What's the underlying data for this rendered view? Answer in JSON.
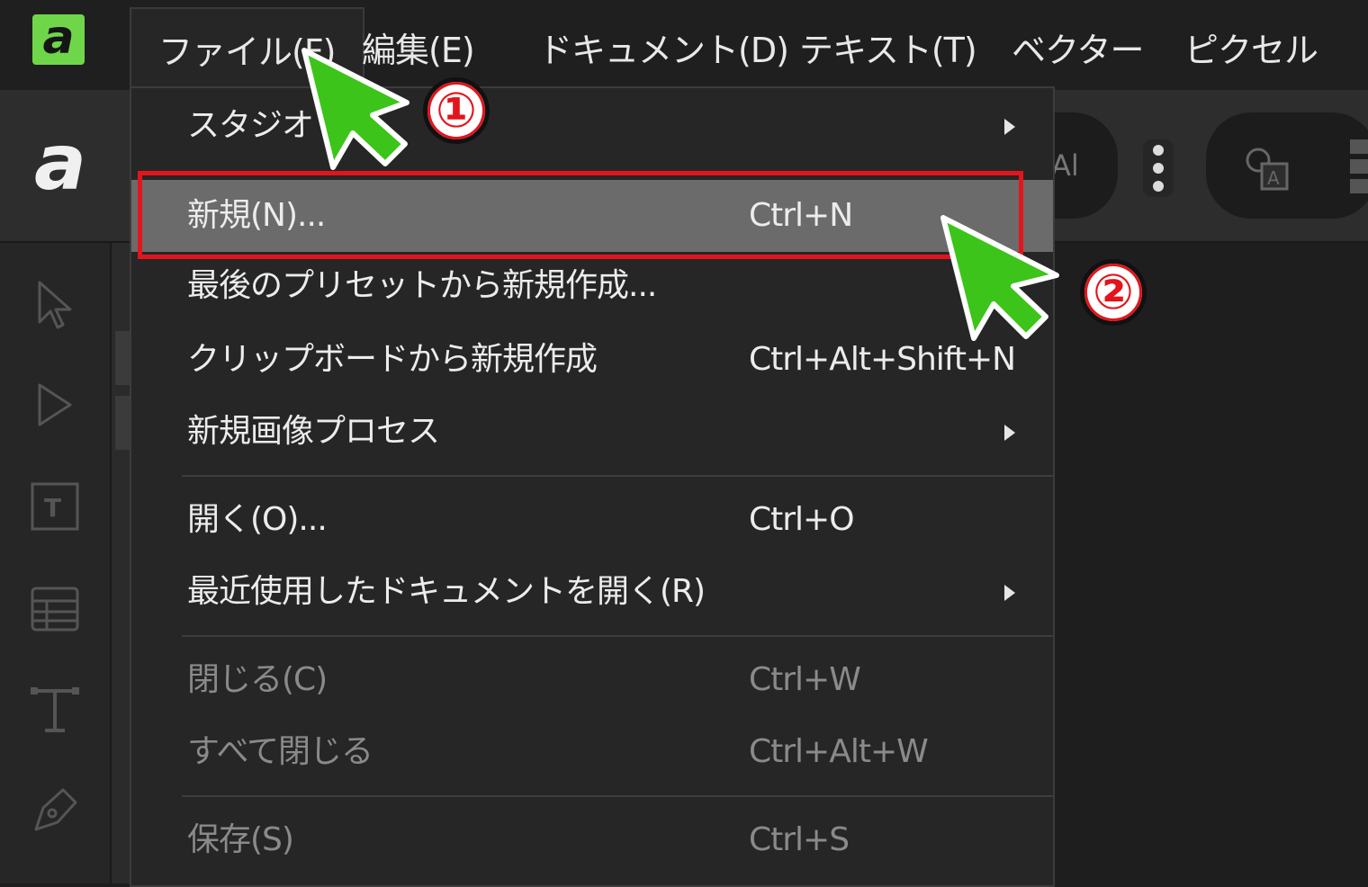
{
  "app": {
    "logo_letter": "a",
    "accent_color": "#6fd64a"
  },
  "menubar": {
    "items": [
      {
        "label": "ファイル(F)"
      },
      {
        "label": "編集(E)"
      },
      {
        "label": "ドキュメント(D)"
      },
      {
        "label": "テキスト(T)"
      },
      {
        "label": "ベクター"
      },
      {
        "label": "ピクセル"
      }
    ]
  },
  "toolbar": {
    "logo_letter": "a",
    "partial_label": "Al",
    "icons": [
      "more-vertical-icon",
      "text-frame-icon",
      "grid-icon"
    ]
  },
  "tools": [
    "select-arrow-icon",
    "node-arrow-icon",
    "text-frame-icon",
    "table-icon",
    "artistic-text-icon",
    "pen-icon"
  ],
  "file_menu": {
    "items": [
      {
        "label": "スタジオ",
        "shortcut": "",
        "submenu": true,
        "disabled": false
      },
      {
        "label": "新規(N)...",
        "shortcut": "Ctrl+N",
        "submenu": false,
        "disabled": false,
        "highlighted": true
      },
      {
        "label": "最後のプリセットから新規作成...",
        "shortcut": "",
        "submenu": false,
        "disabled": false
      },
      {
        "label": "クリップボードから新規作成",
        "shortcut": "Ctrl+Alt+Shift+N",
        "submenu": false,
        "disabled": false
      },
      {
        "label": "新規画像プロセス",
        "shortcut": "",
        "submenu": true,
        "disabled": false
      },
      {
        "label": "開く(O)...",
        "shortcut": "Ctrl+O",
        "submenu": false,
        "disabled": false
      },
      {
        "label": "最近使用したドキュメントを開く(R)",
        "shortcut": "",
        "submenu": true,
        "disabled": false
      },
      {
        "label": "閉じる(C)",
        "shortcut": "Ctrl+W",
        "submenu": false,
        "disabled": true
      },
      {
        "label": "すべて閉じる",
        "shortcut": "Ctrl+Alt+W",
        "submenu": false,
        "disabled": true
      },
      {
        "label": "保存(S)",
        "shortcut": "Ctrl+S",
        "submenu": false,
        "disabled": true
      }
    ]
  },
  "annotations": {
    "step1": "①",
    "step2": "②",
    "box_color": "#e3141b",
    "cursor_color": "#3cc41a"
  }
}
